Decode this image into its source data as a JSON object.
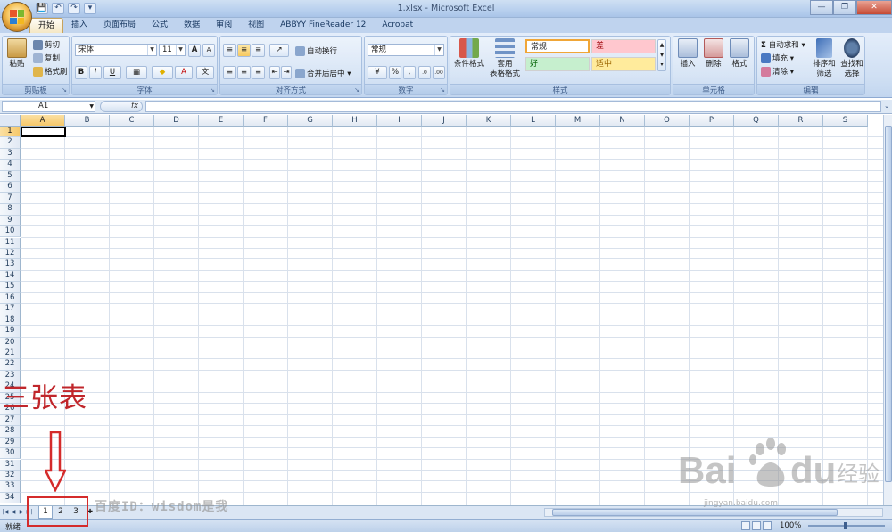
{
  "window": {
    "title": "1.xlsx - Microsoft Excel",
    "controls": [
      "—",
      "❐",
      "✕"
    ]
  },
  "qat": [
    "💾",
    "↶",
    "↷",
    "▾"
  ],
  "ribbon_tabs": [
    "开始",
    "插入",
    "页面布局",
    "公式",
    "数据",
    "审阅",
    "视图",
    "ABBYY FineReader 12",
    "Acrobat"
  ],
  "ribbon": {
    "clipboard": {
      "label": "剪贴板",
      "paste": "粘贴",
      "cut": "剪切",
      "copy": "复制",
      "format_painter": "格式刷"
    },
    "font": {
      "label": "字体",
      "font_name": "宋体",
      "font_size": "11",
      "bold": "B",
      "italic": "I",
      "underline": "U",
      "grow": "A",
      "shrink": "A"
    },
    "alignment": {
      "label": "对齐方式",
      "wrap_text": "自动换行",
      "merge_center": "合并后居中"
    },
    "number": {
      "label": "数字",
      "format": "常规",
      "percent": "%",
      "comma": ","
    },
    "styles": {
      "label": "样式",
      "conditional": "条件格式",
      "table_format_1": "套用",
      "table_format_2": "表格格式",
      "cell_normal": "常规",
      "cell_bad": "差",
      "cell_good": "好",
      "cell_neutral": "适中"
    },
    "cells": {
      "label": "单元格",
      "insert": "插入",
      "delete": "删除",
      "format": "格式"
    },
    "editing": {
      "label": "编辑",
      "autosum": "自动求和",
      "fill": "填充",
      "clear": "清除",
      "sort_filter_1": "排序和",
      "sort_filter_2": "筛选",
      "find_select_1": "查找和",
      "find_select_2": "选择"
    }
  },
  "formula_bar": {
    "name_box": "A1",
    "fx": "fx",
    "value": ""
  },
  "columns": [
    "A",
    "B",
    "C",
    "D",
    "E",
    "F",
    "G",
    "H",
    "I",
    "J",
    "K",
    "L",
    "M",
    "N",
    "O",
    "P",
    "Q",
    "R",
    "S"
  ],
  "rows": [
    "1",
    "2",
    "3",
    "4",
    "5",
    "6",
    "7",
    "8",
    "9",
    "10",
    "11",
    "12",
    "13",
    "14",
    "15",
    "16",
    "17",
    "18",
    "19",
    "20",
    "21",
    "22",
    "23",
    "24",
    "25",
    "26",
    "27",
    "28",
    "29",
    "30",
    "31",
    "32",
    "33",
    "34"
  ],
  "sheet_tabs": [
    "1",
    "2",
    "3"
  ],
  "status": {
    "ready": "就绪",
    "zoom": "100%"
  },
  "annotation": {
    "text": "三张表"
  },
  "watermark": {
    "id_text": "百度ID：wisdom是我",
    "brand": "Bai",
    "brand2": "经验",
    "site": "jingyan.baidu.com"
  },
  "colors": {
    "accent": "#c0262b",
    "ribbon": "#cfdff3",
    "selection": "#f6c86a"
  }
}
